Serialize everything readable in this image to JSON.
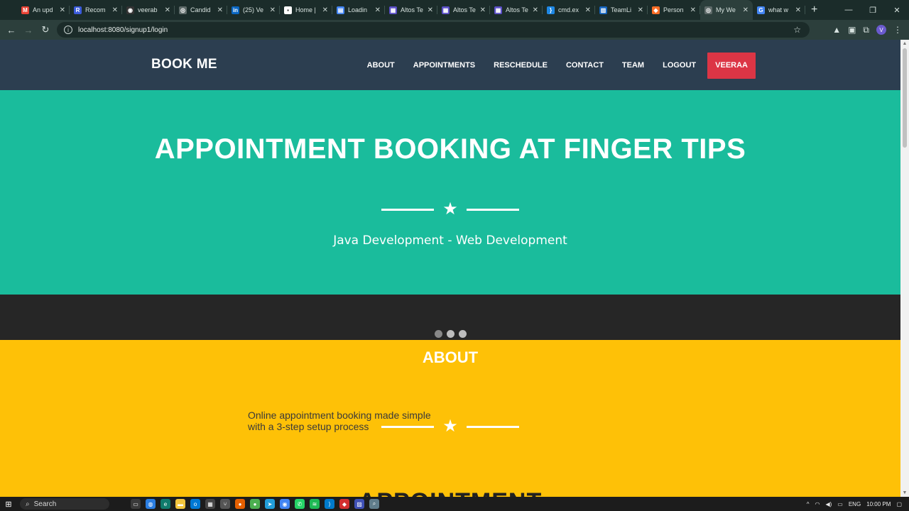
{
  "browser": {
    "tabs": [
      {
        "title": "An upd",
        "icon": "gmail-icon",
        "color": "#ea4335",
        "glyph": "M"
      },
      {
        "title": "Recom",
        "icon": "recommend-icon",
        "color": "#3b5bdb",
        "glyph": "R"
      },
      {
        "title": "veerab",
        "icon": "github-icon",
        "color": "#333333",
        "glyph": "◉"
      },
      {
        "title": "Candid",
        "icon": "globe-icon",
        "color": "#5f6b6a",
        "glyph": "◎"
      },
      {
        "title": "(25) Ve",
        "icon": "linkedin-icon",
        "color": "#0a66c2",
        "glyph": "in"
      },
      {
        "title": "Home |",
        "icon": "site-icon",
        "color": "#ffffff",
        "glyph": "▪"
      },
      {
        "title": "Loadin",
        "icon": "docs-icon",
        "color": "#4285f4",
        "glyph": "▤"
      },
      {
        "title": "Altos Te",
        "icon": "altos-icon",
        "color": "#5b4fc7",
        "glyph": "▦"
      },
      {
        "title": "Altos Te",
        "icon": "altos-icon",
        "color": "#5b4fc7",
        "glyph": "▦"
      },
      {
        "title": "Altos Te",
        "icon": "altos-icon",
        "color": "#5b4fc7",
        "glyph": "▦"
      },
      {
        "title": "cmd.ex",
        "icon": "json-icon",
        "color": "#1e88e5",
        "glyph": "}"
      },
      {
        "title": "TeamLi",
        "icon": "teamlist-icon",
        "color": "#1565c0",
        "glyph": "▥"
      },
      {
        "title": "Person",
        "icon": "gitlab-icon",
        "color": "#fc6d26",
        "glyph": "◆"
      },
      {
        "title": "My We",
        "icon": "globe-icon",
        "color": "#5f6b6a",
        "glyph": "◎",
        "active": true
      },
      {
        "title": "what w",
        "icon": "google-icon",
        "color": "#4285f4",
        "glyph": "G"
      }
    ],
    "url": "localhost:8080/signup1/login",
    "profile_initial": "V"
  },
  "site": {
    "brand": "BOOK ME",
    "menu": [
      "ABOUT",
      "APPOINTMENTS",
      "RESCHEDULE",
      "CONTACT",
      "TEAM",
      "LOGOUT"
    ],
    "user": "VEERAA",
    "hero": {
      "title": "APPOINTMENT BOOKING AT FINGER TIPS",
      "subtitle": "Java Development - Web Development"
    },
    "about": {
      "title": "ABOUT",
      "text": "Online appointment booking made simple with a 3-step setup process"
    },
    "next_section_title": "APPOINTMENT"
  },
  "taskbar": {
    "search_placeholder": "Search",
    "language": "ENG",
    "time": "10:00 PM"
  },
  "colors": {
    "nav": "#2c3e50",
    "hero": "#1abc9c",
    "carousel": "#262626",
    "about": "#fec107",
    "user_button": "#dc3545"
  }
}
